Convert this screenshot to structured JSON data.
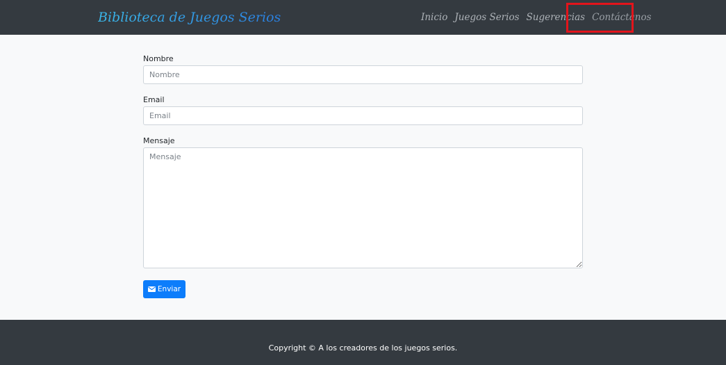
{
  "navbar": {
    "brand": "Biblioteca de Juegos Serios",
    "links": [
      "Inicio",
      "Juegos Serios",
      "Sugerencias",
      "Contáctanos"
    ],
    "active_link": "Contáctanos"
  },
  "form": {
    "name_label": "Nombre",
    "name_placeholder": "Nombre",
    "email_label": "Email",
    "email_placeholder": "Email",
    "message_label": "Mensaje",
    "message_placeholder": "Mensaje",
    "submit_label": "Enviar",
    "submit_icon": "envelope-icon"
  },
  "footer": {
    "copyright": "Copyright © A los creadores de los juegos serios."
  },
  "colors": {
    "navbar_bg": "#343a40",
    "primary_button": "#0d7dfb",
    "highlight": "#e3141b"
  }
}
